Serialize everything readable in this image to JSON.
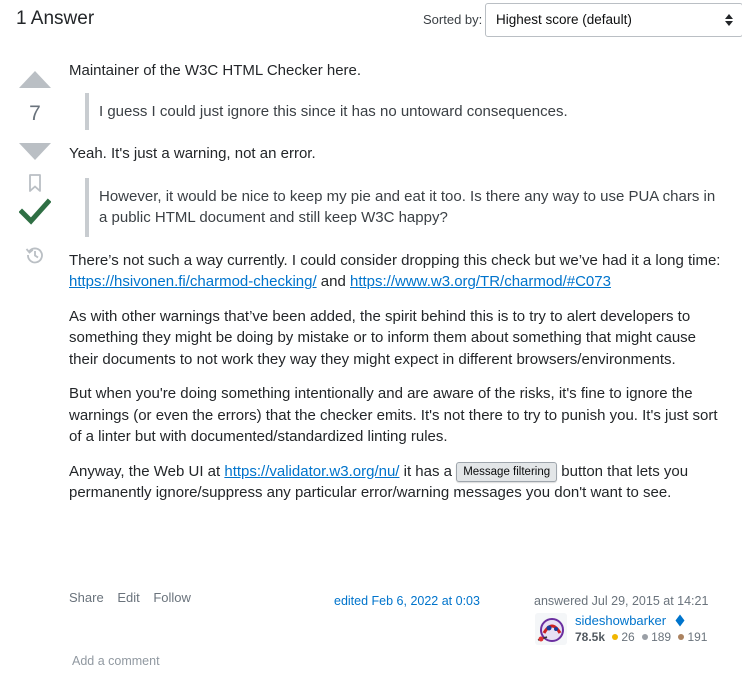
{
  "header": {
    "answers_count": "1 Answer",
    "sort_label": "Sorted by:",
    "sort_value": "Highest score (default)"
  },
  "vote": {
    "score": "7",
    "accepted": true
  },
  "post": {
    "intro": "Maintainer of the W3C HTML Checker here.",
    "quote1": "I guess I could just ignore this since it has no untoward consequences.",
    "reply1": "Yeah. It's just a warning, not an error.",
    "quote2": "However, it would be nice to keep my pie and eat it too. Is there any way to use PUA chars in a public HTML document and still keep W3C happy?",
    "p3_text": "There’s not such a way currently. I could consider dropping this check but we’ve had it a long time:",
    "p3_link1": "https://hsivonen.fi/charmod-checking/",
    "p3_and": "and",
    "p3_link2": "https://www.w3.org/TR/charmod/#C073",
    "p4": "As with other warnings that’ve been added, the spirit behind this is to try to alert developers to something they might be doing by mistake or to inform them about something that might cause their documents to not work they way they might expect in different browsers/environments.",
    "p5": "But when you're doing something intentionally and are aware of the risks, it's fine to ignore the warnings (or even the errors) that the checker emits. It's not there to try to punish you. It's just sort of a linter but with documented/standardized linting rules.",
    "p6_before": "Anyway, the Web UI at",
    "p6_link": "https://validator.w3.org/nu/",
    "p6_mid": "it has a",
    "p6_button": "Message filtering",
    "p6_after": "button that lets you permanently ignore/suppress any particular error/warning messages you don't want to see."
  },
  "footer": {
    "share": "Share",
    "edit": "Edit",
    "follow": "Follow",
    "edited": "edited Feb 6, 2022 at 0:03",
    "answered": "answered Jul 29, 2015 at 14:21",
    "user": {
      "name": "sideshowbarker",
      "reputation": "78.5k",
      "gold": "26",
      "silver": "189",
      "bronze": "191"
    },
    "add_comment": "Add a comment"
  },
  "colors": {
    "accent": "#0074cc",
    "accepted": "#2f6f44",
    "gold": "#f1b600",
    "silver": "#9a9fa6",
    "bronze": "#ab825f",
    "moderator_diamond": "#0074cc"
  },
  "icons": [
    "upvote-arrow-icon",
    "downvote-arrow-icon",
    "bookmark-icon",
    "accepted-check-icon",
    "history-icon",
    "sort-arrows-icon",
    "moderator-diamond-icon"
  ]
}
